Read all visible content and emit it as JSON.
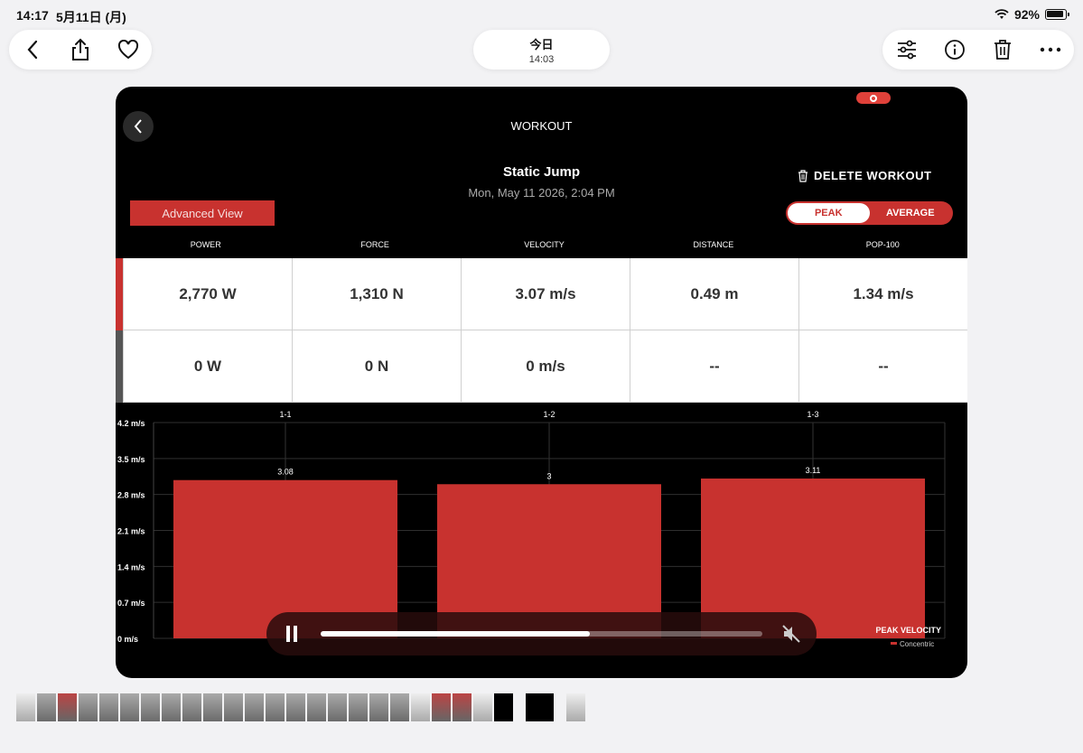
{
  "status_bar": {
    "time": "14:17",
    "date": "5月11日 (月)",
    "battery": "92%"
  },
  "top_bar": {
    "center_title": "今日",
    "center_subtitle": "14:03"
  },
  "workout": {
    "header": "WORKOUT",
    "exercise": "Static Jump",
    "datetime": "Mon, May 11 2026, 2:04 PM",
    "delete_label": "DELETE WORKOUT",
    "advanced_view_label": "Advanced View",
    "toggle": {
      "peak": "PEAK",
      "average": "AVERAGE",
      "selected": "PEAK"
    },
    "metric_headers": [
      "POWER",
      "FORCE",
      "VELOCITY",
      "DISTANCE",
      "POP-100"
    ],
    "rows": [
      {
        "accent_color": "#c8322f",
        "values": [
          "2,770 W",
          "1,310 N",
          "3.07 m/s",
          "0.49 m",
          "1.34 m/s"
        ]
      },
      {
        "accent_color": "#555555",
        "values": [
          "0 W",
          "0 N",
          "0 m/s",
          "--",
          "--"
        ]
      }
    ]
  },
  "chart_data": {
    "type": "bar",
    "categories": [
      "1-1",
      "1-2",
      "1-3"
    ],
    "values": [
      3.08,
      3,
      3.11
    ],
    "value_labels": [
      "3.08",
      "3",
      "3.11"
    ],
    "y_ticks": [
      "0 m/s",
      "0.7 m/s",
      "1.4 m/s",
      "2.1 m/s",
      "2.8 m/s",
      "3.5 m/s",
      "4.2 m/s"
    ],
    "ylim": [
      0,
      4.2
    ],
    "legend_title": "PEAK VELOCITY",
    "legend_entry": "Concentric",
    "bar_color": "#c8322f",
    "grid": true
  },
  "video_player": {
    "progress": 0.61
  },
  "colors": {
    "accent": "#c8322f",
    "panel_bg": "#000000"
  }
}
